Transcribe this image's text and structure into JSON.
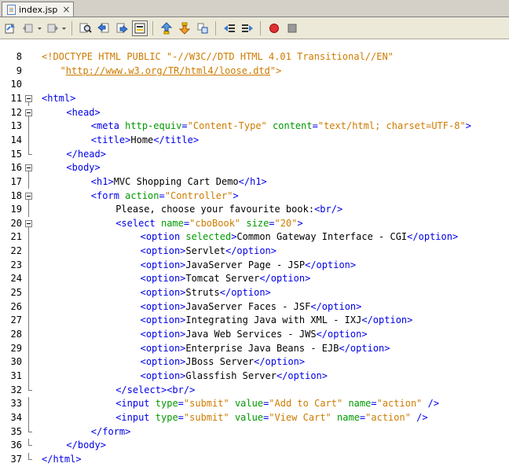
{
  "tab": {
    "title": "index.jsp",
    "close": "×"
  },
  "toolbar": {
    "buttons": [
      {
        "name": "last-edit-icon"
      },
      {
        "name": "back-icon"
      },
      {
        "name": "forward-icon"
      },
      {
        "name": "find-icon"
      },
      {
        "name": "find-previous-icon"
      },
      {
        "name": "find-next-icon"
      },
      {
        "name": "toggle-highlight-icon"
      },
      {
        "name": "previous-bookmark-icon"
      },
      {
        "name": "next-bookmark-icon"
      },
      {
        "name": "toggle-bookmark-icon"
      },
      {
        "name": "shift-left-icon"
      },
      {
        "name": "shift-right-icon"
      },
      {
        "name": "start-macro-icon"
      },
      {
        "name": "stop-macro-icon"
      }
    ]
  },
  "lines": [
    {
      "n": "8",
      "indent": 0,
      "fold": "",
      "segs": [
        {
          "t": "doc",
          "v": "<!DOCTYPE HTML PUBLIC \"-//W3C//DTD HTML 4.01 Transitional//EN\""
        }
      ]
    },
    {
      "n": "9",
      "indent": 3,
      "fold": "",
      "segs": [
        {
          "t": "doc",
          "v": "\""
        },
        {
          "t": "url",
          "v": "http://www.w3.org/TR/html4/loose.dtd"
        },
        {
          "t": "doc",
          "v": "\">"
        }
      ]
    },
    {
      "n": "10",
      "indent": 0,
      "fold": "",
      "segs": []
    },
    {
      "n": "11",
      "indent": 0,
      "fold": "open",
      "segs": [
        {
          "t": "tag",
          "v": "<html>"
        }
      ]
    },
    {
      "n": "12",
      "indent": 4,
      "fold": "open",
      "segs": [
        {
          "t": "tag",
          "v": "<head>"
        }
      ]
    },
    {
      "n": "13",
      "indent": 8,
      "fold": "line",
      "segs": [
        {
          "t": "tag",
          "v": "<meta "
        },
        {
          "t": "attr",
          "v": "http-equiv"
        },
        {
          "t": "tag",
          "v": "="
        },
        {
          "t": "val",
          "v": "\"Content-Type\""
        },
        {
          "t": "tag",
          "v": " "
        },
        {
          "t": "attr",
          "v": "content"
        },
        {
          "t": "tag",
          "v": "="
        },
        {
          "t": "val",
          "v": "\"text/html; charset=UTF-8\""
        },
        {
          "t": "tag",
          "v": ">"
        }
      ]
    },
    {
      "n": "14",
      "indent": 8,
      "fold": "line",
      "segs": [
        {
          "t": "tag",
          "v": "<title>"
        },
        {
          "t": "txt",
          "v": "Home"
        },
        {
          "t": "tag",
          "v": "</title>"
        }
      ]
    },
    {
      "n": "15",
      "indent": 4,
      "fold": "end",
      "segs": [
        {
          "t": "tag",
          "v": "</head>"
        }
      ]
    },
    {
      "n": "16",
      "indent": 4,
      "fold": "open",
      "segs": [
        {
          "t": "tag",
          "v": "<body>"
        }
      ]
    },
    {
      "n": "17",
      "indent": 8,
      "fold": "line",
      "segs": [
        {
          "t": "tag",
          "v": "<h1>"
        },
        {
          "t": "txt",
          "v": "MVC Shopping Cart Demo"
        },
        {
          "t": "tag",
          "v": "</h1>"
        }
      ]
    },
    {
      "n": "18",
      "indent": 8,
      "fold": "open",
      "segs": [
        {
          "t": "tag",
          "v": "<form "
        },
        {
          "t": "attr",
          "v": "action"
        },
        {
          "t": "tag",
          "v": "="
        },
        {
          "t": "val",
          "v": "\"Controller\""
        },
        {
          "t": "tag",
          "v": ">"
        }
      ]
    },
    {
      "n": "19",
      "indent": 12,
      "fold": "line",
      "segs": [
        {
          "t": "txt",
          "v": "Please, choose your favourite book:"
        },
        {
          "t": "tag",
          "v": "<br/>"
        }
      ]
    },
    {
      "n": "20",
      "indent": 12,
      "fold": "open",
      "segs": [
        {
          "t": "tag",
          "v": "<select "
        },
        {
          "t": "attr",
          "v": "name"
        },
        {
          "t": "tag",
          "v": "="
        },
        {
          "t": "val",
          "v": "\"cboBook\""
        },
        {
          "t": "tag",
          "v": " "
        },
        {
          "t": "attr",
          "v": "size"
        },
        {
          "t": "tag",
          "v": "="
        },
        {
          "t": "val",
          "v": "\"20\""
        },
        {
          "t": "tag",
          "v": ">"
        }
      ]
    },
    {
      "n": "21",
      "indent": 16,
      "fold": "line",
      "segs": [
        {
          "t": "tag",
          "v": "<option "
        },
        {
          "t": "attr",
          "v": "selected"
        },
        {
          "t": "tag",
          "v": ">"
        },
        {
          "t": "txt",
          "v": "Common Gateway Interface - CGI"
        },
        {
          "t": "tag",
          "v": "</option>"
        }
      ]
    },
    {
      "n": "22",
      "indent": 16,
      "fold": "line",
      "segs": [
        {
          "t": "tag",
          "v": "<option>"
        },
        {
          "t": "txt",
          "v": "Servlet"
        },
        {
          "t": "tag",
          "v": "</option>"
        }
      ]
    },
    {
      "n": "23",
      "indent": 16,
      "fold": "line",
      "segs": [
        {
          "t": "tag",
          "v": "<option>"
        },
        {
          "t": "txt",
          "v": "JavaServer Page - JSP"
        },
        {
          "t": "tag",
          "v": "</option>"
        }
      ]
    },
    {
      "n": "24",
      "indent": 16,
      "fold": "line",
      "segs": [
        {
          "t": "tag",
          "v": "<option>"
        },
        {
          "t": "txt",
          "v": "Tomcat Server"
        },
        {
          "t": "tag",
          "v": "</option>"
        }
      ]
    },
    {
      "n": "25",
      "indent": 16,
      "fold": "line",
      "segs": [
        {
          "t": "tag",
          "v": "<option>"
        },
        {
          "t": "txt",
          "v": "Struts"
        },
        {
          "t": "tag",
          "v": "</option>"
        }
      ]
    },
    {
      "n": "26",
      "indent": 16,
      "fold": "line",
      "segs": [
        {
          "t": "tag",
          "v": "<option>"
        },
        {
          "t": "txt",
          "v": "JavaServer Faces - JSF"
        },
        {
          "t": "tag",
          "v": "</option>"
        }
      ]
    },
    {
      "n": "27",
      "indent": 16,
      "fold": "line",
      "segs": [
        {
          "t": "tag",
          "v": "<option>"
        },
        {
          "t": "txt",
          "v": "Integrating Java with XML - IXJ"
        },
        {
          "t": "tag",
          "v": "</option>"
        }
      ]
    },
    {
      "n": "28",
      "indent": 16,
      "fold": "line",
      "segs": [
        {
          "t": "tag",
          "v": "<option>"
        },
        {
          "t": "txt",
          "v": "Java Web Services - JWS"
        },
        {
          "t": "tag",
          "v": "</option>"
        }
      ]
    },
    {
      "n": "29",
      "indent": 16,
      "fold": "line",
      "segs": [
        {
          "t": "tag",
          "v": "<option>"
        },
        {
          "t": "txt",
          "v": "Enterprise Java Beans - EJB"
        },
        {
          "t": "tag",
          "v": "</option>"
        }
      ]
    },
    {
      "n": "30",
      "indent": 16,
      "fold": "line",
      "segs": [
        {
          "t": "tag",
          "v": "<option>"
        },
        {
          "t": "txt",
          "v": "JBoss Server"
        },
        {
          "t": "tag",
          "v": "</option>"
        }
      ]
    },
    {
      "n": "31",
      "indent": 16,
      "fold": "line",
      "segs": [
        {
          "t": "tag",
          "v": "<option>"
        },
        {
          "t": "txt",
          "v": "Glassfish Server"
        },
        {
          "t": "tag",
          "v": "</option>"
        }
      ]
    },
    {
      "n": "32",
      "indent": 12,
      "fold": "end",
      "segs": [
        {
          "t": "tag",
          "v": "</select><br/>"
        }
      ]
    },
    {
      "n": "33",
      "indent": 12,
      "fold": "line",
      "segs": [
        {
          "t": "tag",
          "v": "<input "
        },
        {
          "t": "attr",
          "v": "type"
        },
        {
          "t": "tag",
          "v": "="
        },
        {
          "t": "val",
          "v": "\"submit\""
        },
        {
          "t": "tag",
          "v": " "
        },
        {
          "t": "attr",
          "v": "value"
        },
        {
          "t": "tag",
          "v": "="
        },
        {
          "t": "val",
          "v": "\"Add to Cart\""
        },
        {
          "t": "tag",
          "v": " "
        },
        {
          "t": "attr",
          "v": "name"
        },
        {
          "t": "tag",
          "v": "="
        },
        {
          "t": "val",
          "v": "\"action\""
        },
        {
          "t": "tag",
          "v": " />"
        }
      ]
    },
    {
      "n": "34",
      "indent": 12,
      "fold": "line",
      "segs": [
        {
          "t": "tag",
          "v": "<input "
        },
        {
          "t": "attr",
          "v": "type"
        },
        {
          "t": "tag",
          "v": "="
        },
        {
          "t": "val",
          "v": "\"submit\""
        },
        {
          "t": "tag",
          "v": " "
        },
        {
          "t": "attr",
          "v": "value"
        },
        {
          "t": "tag",
          "v": "="
        },
        {
          "t": "val",
          "v": "\"View Cart\""
        },
        {
          "t": "tag",
          "v": " "
        },
        {
          "t": "attr",
          "v": "name"
        },
        {
          "t": "tag",
          "v": "="
        },
        {
          "t": "val",
          "v": "\"action\""
        },
        {
          "t": "tag",
          "v": " />"
        }
      ]
    },
    {
      "n": "35",
      "indent": 8,
      "fold": "end",
      "segs": [
        {
          "t": "tag",
          "v": "</form>"
        }
      ]
    },
    {
      "n": "36",
      "indent": 4,
      "fold": "end",
      "segs": [
        {
          "t": "tag",
          "v": "</body>"
        }
      ]
    },
    {
      "n": "37",
      "indent": 0,
      "fold": "end",
      "segs": [
        {
          "t": "tag",
          "v": "</html>"
        }
      ]
    }
  ],
  "colors": {
    "tag": "#0000e6",
    "attribute": "#009900",
    "value": "#ce7b00",
    "text": "#000000"
  }
}
